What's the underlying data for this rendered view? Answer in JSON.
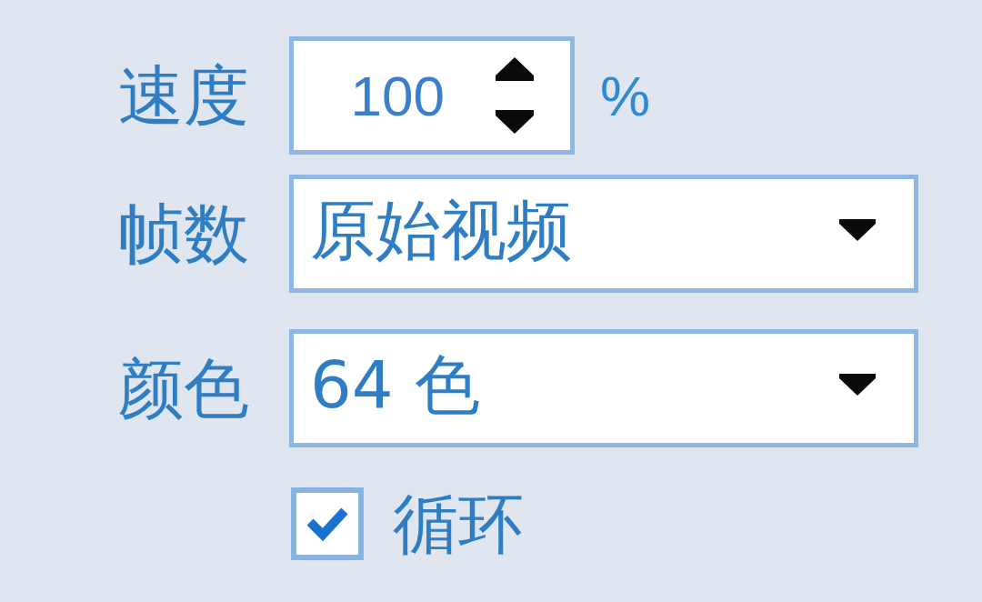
{
  "fields": [
    {
      "kind": "spinner",
      "label": "速度",
      "value": "100",
      "unit": "%"
    },
    {
      "kind": "dropdown",
      "label": "帧数",
      "value": "原始视频"
    },
    {
      "kind": "dropdown",
      "label": "颜色",
      "value": "64 色"
    },
    {
      "kind": "checkbox",
      "label": "循环",
      "checked": true
    }
  ]
}
